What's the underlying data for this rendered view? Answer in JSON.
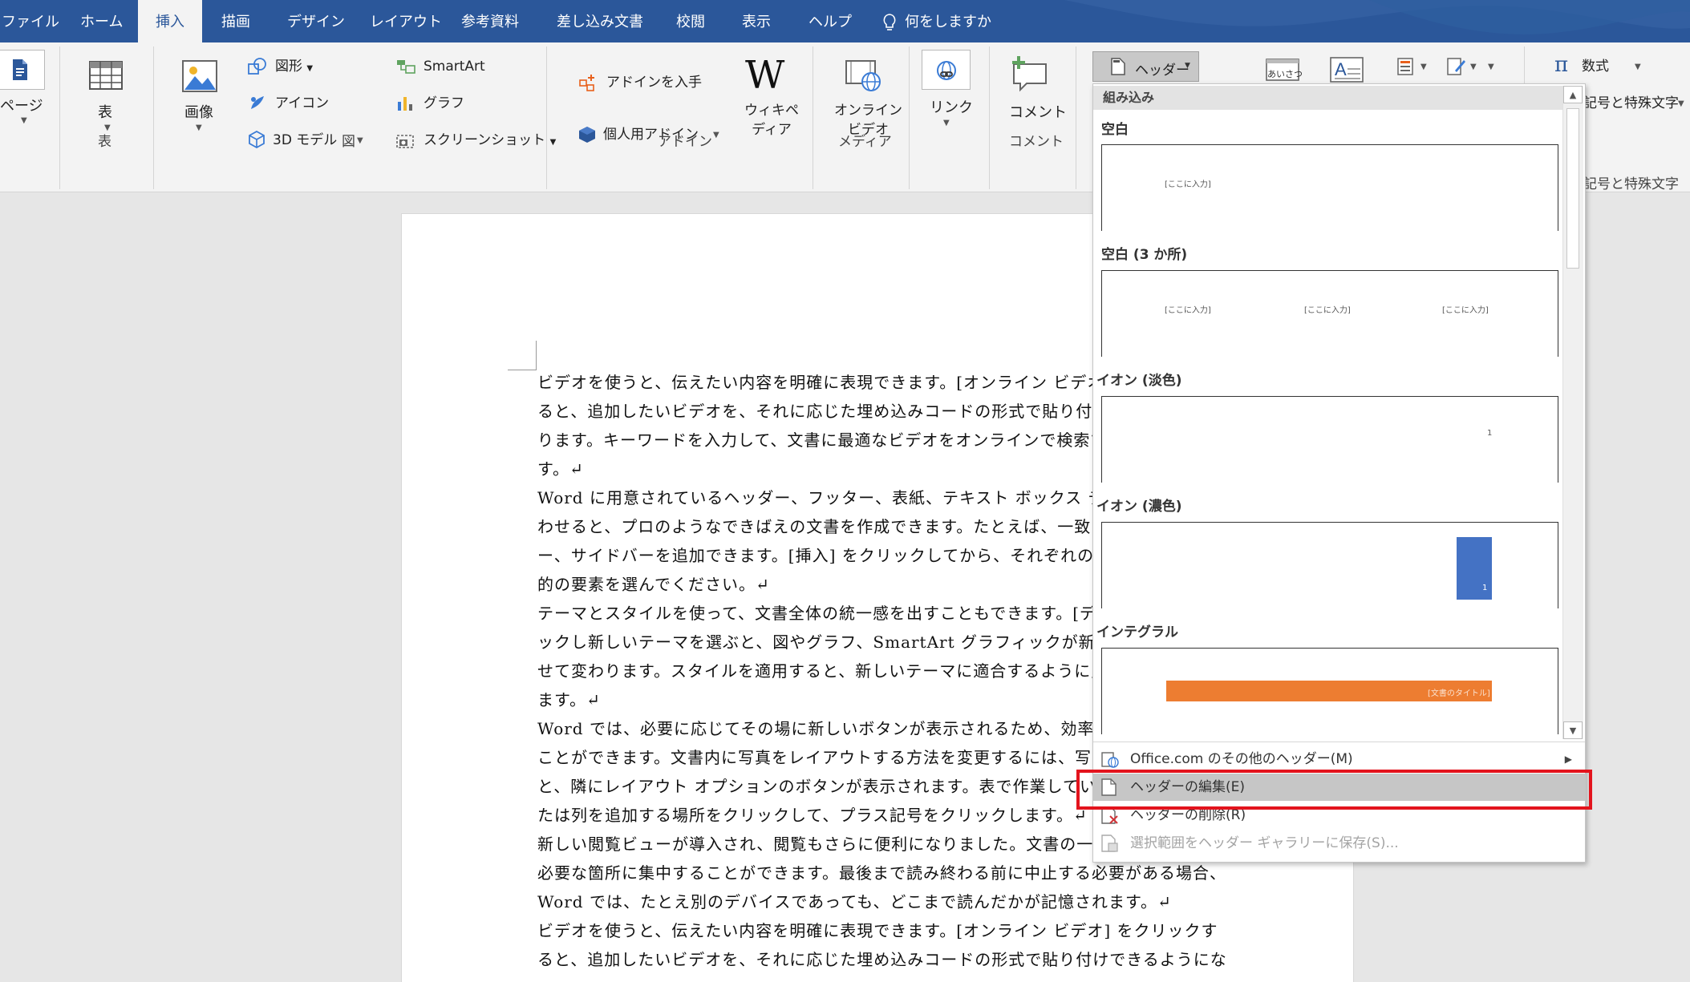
{
  "tabs": [
    "ファイル",
    "ホーム",
    "挿入",
    "描画",
    "デザイン",
    "レイアウト",
    "参考資料",
    "差し込み文書",
    "校閲",
    "表示",
    "ヘルプ"
  ],
  "tell_me": "何をしますか",
  "ribbon": {
    "page_label": "ページ",
    "table_label": "表",
    "group_table": "表",
    "image_label": "画像",
    "shapes_label": "図形",
    "icons_label": "アイコン",
    "model3d_label": "3D モデル",
    "smartart_label": "SmartArt",
    "graph_label": "グラフ",
    "screenshot_label": "スクリーンショット",
    "group_figure": "図",
    "get_addin_label": "アドインを入手",
    "personal_addin_label": "個人用アドイン",
    "wikipedia_label_1": "ウィキペ",
    "wikipedia_label_2": "ディア",
    "group_addin": "アドイン",
    "online_video_label_1": "オンライン",
    "online_video_label_2": "ビデオ",
    "group_media": "メディア",
    "link_label": "リンク",
    "comment_label": "コメント",
    "group_comment": "コメント",
    "header_label": "ヘッダー",
    "greeting_label": "あいさつ",
    "equation_label": "数式",
    "symbols_label": "記号と特殊文字",
    "group_symbols": "記号と特殊文字"
  },
  "document": {
    "lines": [
      "ビデオを使うと、伝えたい内容を明確に表現できます。[オンライン ビデオ",
      "ると、追加したいビデオを、それに応じた埋め込みコードの形式で貼り付け",
      "ります。キーワードを入力して、文書に最適なビデオをオンラインで検索す",
      "す。↵",
      "Word に用意されているヘッダー、フッター、表紙、テキスト ボックス デ",
      "わせると、プロのようなできばえの文書を作成できます。たとえば、一致す",
      "ー、サイドバーを追加できます。[挿入] をクリックしてから、それぞれの",
      "的の要素を選んでください。↵",
      "テーマとスタイルを使って、文書全体の統一感を出すこともできます。[デ",
      "ックし新しいテーマを選ぶと、図やグラフ、SmartArt グラフィックが新し",
      "せて変わります。スタイルを適用すると、新しいテーマに適合するように見",
      "ます。↵",
      "Word では、必要に応じてその場に新しいボタンが表示されるため、効率よ",
      "ことができます。文書内に写真をレイアウトする方法を変更するには、写真",
      "と、隣にレイアウト オプションのボタンが表示されます。表で作業してい",
      "たは列を追加する場所をクリックして、プラス記号をクリックします。↵",
      "新しい閲覧ビューが導入され、閲覧もさらに便利になりました。文書の一部",
      "必要な箇所に集中することができます。最後まで読み終わる前に中止する必要がある場合、",
      "Word では、たとえ別のデバイスであっても、どこまで読んだかが記憶されます。↵",
      "ビデオを使うと、伝えたい内容を明確に表現できます。[オンライン ビデオ] をクリックす",
      "ると、追加したいビデオを、それに応じた埋め込みコードの形式で貼り付けできるようにな"
    ]
  },
  "dropdown": {
    "category": "組み込み",
    "galleries": [
      {
        "name": "空白",
        "placeholders": [
          "[ここに入力]"
        ]
      },
      {
        "name": "空白 (3 か所)",
        "placeholders": [
          "[ここに入力]",
          "[ここに入力]",
          "[ここに入力]"
        ]
      },
      {
        "name": "イオン (淡色)",
        "placeholders": [
          "1"
        ]
      },
      {
        "name": "イオン (濃色)",
        "placeholders": [
          "1"
        ]
      },
      {
        "name": "インテグラル",
        "placeholders": [
          "[文書のタイトル]"
        ]
      }
    ],
    "items": [
      {
        "label": "Office.com のその他のヘッダー(M)",
        "state": "normal"
      },
      {
        "label": "ヘッダーの編集(E)",
        "state": "hover"
      },
      {
        "label": "ヘッダーの削除(R)",
        "state": "normal"
      },
      {
        "label": "選択範囲をヘッダー ギャラリーに保存(S)...",
        "state": "disabled"
      }
    ]
  },
  "colors": {
    "tab_bar": "#2b579a",
    "ribbon": "#f3f3f3",
    "highlight": "#e3141d",
    "ion_dark": "#4472c4",
    "integral": "#ed7d31"
  }
}
